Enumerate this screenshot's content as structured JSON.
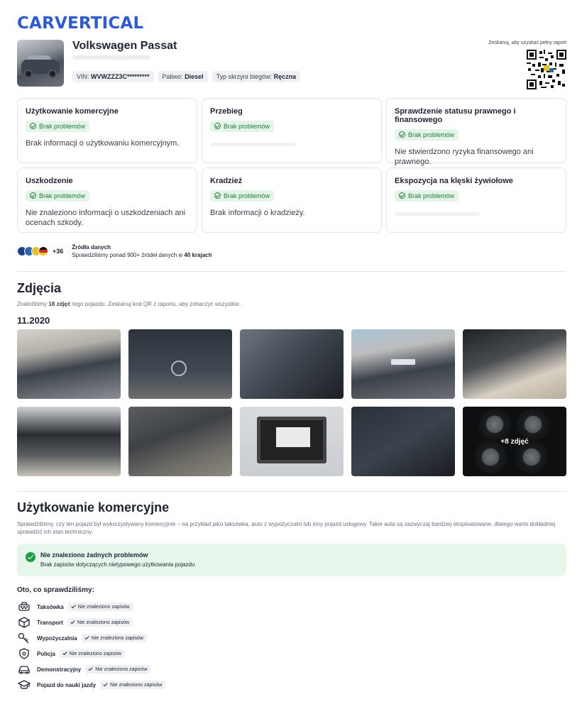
{
  "brand": {
    "logo_text": "CARVERTICAL",
    "color": "#2d5bd8"
  },
  "vehicle": {
    "name": "Volkswagen Passat",
    "vin_label": "VIN:",
    "vin_value": "WVWZZZ3C*********",
    "fuel_label": "Paliwo:",
    "fuel_value": "Diesel",
    "gearbox_label": "Typ skrzyni biegów:",
    "gearbox_value": "Ręczna"
  },
  "qr": {
    "label": "Zeskanuj, aby uzyskać pełny raport"
  },
  "summary_cards": [
    {
      "title": "Użytkowanie komercyjne",
      "badge": "Brak problemów",
      "text": "Brak informacji o użytkowaniu komercyjnym."
    },
    {
      "title": "Przebieg",
      "badge": "Brak problemów",
      "text": ""
    },
    {
      "title": "Sprawdzenie statusu prawnego i finansowego",
      "badge": "Brak problemów",
      "text": "Nie stwierdzono ryzyka finansowego ani prawnego."
    },
    {
      "title": "Uszkodzenie",
      "badge": "Brak problemów",
      "text": "Nie znaleziono informacji o uszkodzeniach ani ocenach szkody."
    },
    {
      "title": "Kradzież",
      "badge": "Brak problemów",
      "text": "Brak informacji o kradzieży."
    },
    {
      "title": "Ekspozycja na klęski żywiołowe",
      "badge": "Brak problemów",
      "text": ""
    }
  ],
  "sources": {
    "count_badge": "+36",
    "heading": "Źródła danych",
    "text_prefix": "Sprawdziliśmy ponad 900+ źródeł danych w ",
    "text_bold": "40 krajach",
    "flag_colors": [
      "#1d3e8f",
      "#2b63b6",
      "#e6c229",
      "#d82a2a"
    ]
  },
  "photos": {
    "heading": "Zdjęcia",
    "info_prefix": "Znaleźliśmy ",
    "info_bold": "18 zdjęć",
    "info_suffix": " tego pojazdu. Zeskanuj kod QR z raportu, aby zobaczyć wszystkie.",
    "date": "11.2020",
    "more_label": "+8 zdjęć"
  },
  "commercial": {
    "heading": "Użytkowanie komercyjne",
    "description": "Sprawdziliśmy, czy ten pojazd był wykorzystywany komercyjnie – na przykład jako taksówka, auto z wypożyczalni lub inny pojazd usługowy. Takie auta są zazwyczaj bardziej eksploatowane, dlatego warto dokładniej sprawdzić ich stan techniczny.",
    "ok_title": "Nie znaleziono żadnych problemów",
    "ok_text": "Brak zapisów dotyczących nietypowego użytkowania pojazdu",
    "checked_title": "Oto, co sprawdziliśmy:",
    "checks": [
      {
        "label": "Taksówka",
        "status": "Nie znaleziono zapisów",
        "icon": "taxi-icon"
      },
      {
        "label": "Transport",
        "status": "Nie znaleziono zapisów",
        "icon": "box-icon"
      },
      {
        "label": "Wypożyczalnia",
        "status": "Nie znaleziono zapisów",
        "icon": "key-icon"
      },
      {
        "label": "Policja",
        "status": "Nie znaleziono zapisów",
        "icon": "shield-icon"
      },
      {
        "label": "Demonstracyjny",
        "status": "Nie znaleziono zapisów",
        "icon": "car-icon"
      },
      {
        "label": "Pojazd do nauki jazdy",
        "status": "Nie znaleziono zapisów",
        "icon": "graduation-cap-icon"
      }
    ]
  },
  "colors": {
    "ok_green": "#1e9b44",
    "badge_bg": "#e4f5e8",
    "ok_bg": "#e6f6ea"
  }
}
